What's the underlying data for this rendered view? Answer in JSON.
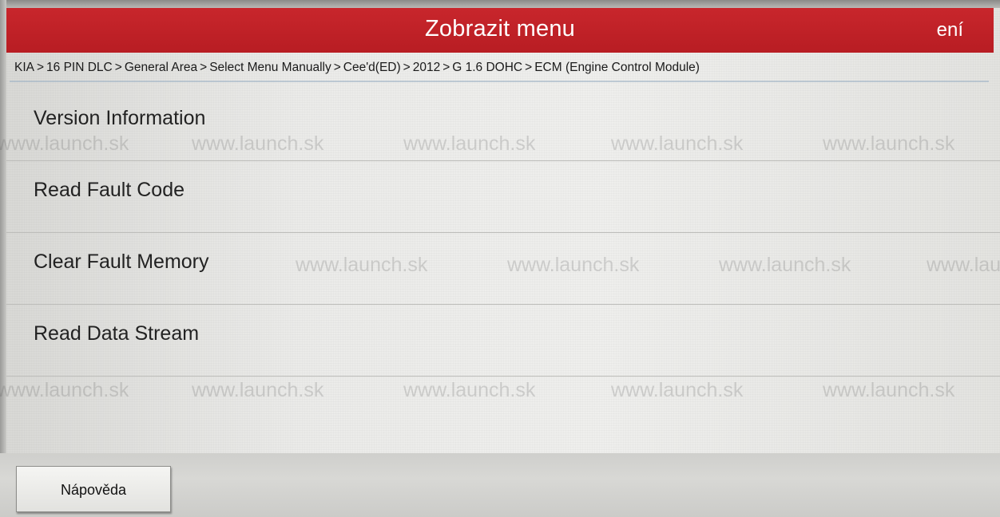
{
  "header": {
    "title": "Zobrazit menu",
    "settings_label": "ení"
  },
  "breadcrumb": [
    "KIA",
    "16 PIN DLC",
    "General Area",
    "Select Menu Manually",
    "Cee'd(ED)",
    "2012",
    "G 1.6 DOHC",
    "ECM (Engine Control Module)"
  ],
  "breadcrumb_separator": ">",
  "menu": {
    "items": [
      {
        "label": "Version Information"
      },
      {
        "label": "Read Fault Code"
      },
      {
        "label": "Clear Fault Memory"
      },
      {
        "label": "Read Data Stream"
      }
    ]
  },
  "footer": {
    "help_label": "Nápověda"
  },
  "watermark": {
    "text": "www.launch.sk"
  },
  "colors": {
    "header_red": "#c0222a",
    "header_text": "#ffffff",
    "background": "#ebebe9"
  }
}
